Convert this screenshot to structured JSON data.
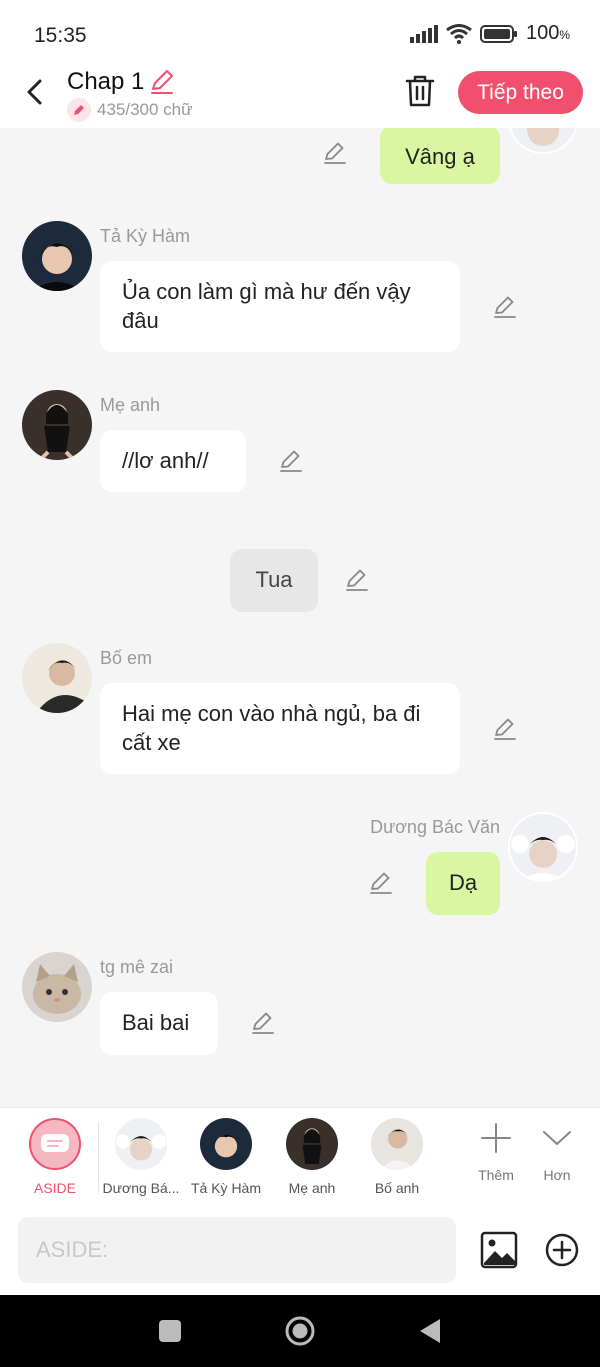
{
  "status": {
    "time": "15:35",
    "battery": "100",
    "battery_unit": "%"
  },
  "header": {
    "title": "Chap 1",
    "word_count": "435/300 chữ",
    "next_label": "Tiếp theo"
  },
  "messages": [
    {
      "type": "right",
      "text": "Vâng ạ"
    },
    {
      "type": "left",
      "name": "Tả Kỳ Hàm",
      "text": "Ủa con làm gì mà hư đến vậy đâu"
    },
    {
      "type": "left",
      "name": "Mẹ anh",
      "text": "//lơ anh//"
    },
    {
      "type": "center",
      "text": "Tua"
    },
    {
      "type": "left",
      "name": "Bố em",
      "text": "Hai mẹ con vào nhà ngủ, ba đi cất xe"
    },
    {
      "type": "right",
      "name": "Dương Bác Văn",
      "text": "Dạ"
    },
    {
      "type": "left",
      "name": "tg mê zai",
      "text": "Bai bai"
    }
  ],
  "characters": [
    {
      "label": "ASIDE"
    },
    {
      "label": "Dương Bá..."
    },
    {
      "label": "Tả Kỳ Hàm"
    },
    {
      "label": "Mẹ anh"
    },
    {
      "label": "Bố anh"
    }
  ],
  "tools": {
    "add_label": "Thêm",
    "more_label": "Hơn"
  },
  "input": {
    "placeholder": "ASIDE:"
  },
  "colors": {
    "accent": "#f0506e",
    "bubble_green": "#d8f7a0",
    "bubble_white": "#ffffff",
    "narration_grey": "#e7e7e7"
  }
}
